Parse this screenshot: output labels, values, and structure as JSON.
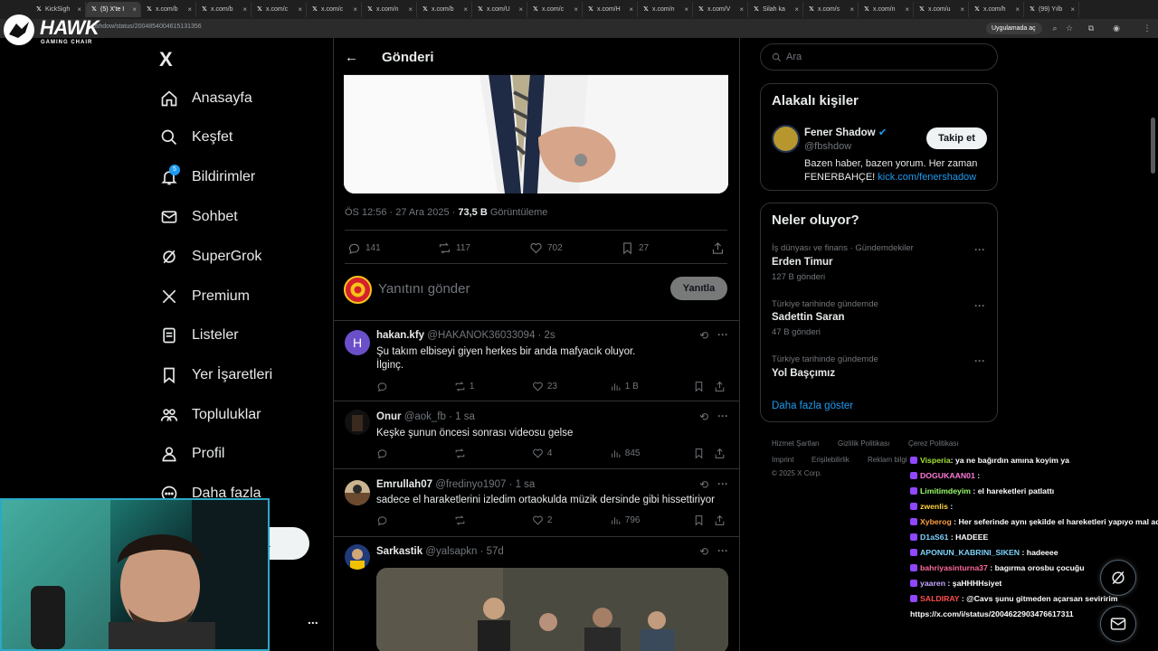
{
  "browser": {
    "tabs": [
      {
        "label": "KickSigh",
        "active": false
      },
      {
        "label": "(5) X'te I",
        "active": true
      },
      {
        "label": "x.com/b",
        "active": false
      },
      {
        "label": "x.com/b",
        "active": false
      },
      {
        "label": "x.com/c",
        "active": false
      },
      {
        "label": "x.com/c",
        "active": false
      },
      {
        "label": "x.com/n",
        "active": false
      },
      {
        "label": "x.com/b",
        "active": false
      },
      {
        "label": "x.com/U",
        "active": false
      },
      {
        "label": "x.com/c",
        "active": false
      },
      {
        "label": "x.com/H",
        "active": false
      },
      {
        "label": "x.com/n",
        "active": false
      },
      {
        "label": "x.com/V",
        "active": false
      },
      {
        "label": "Silah ka",
        "active": false
      },
      {
        "label": "x.com/s",
        "active": false
      },
      {
        "label": "x.com/n",
        "active": false
      },
      {
        "label": "x.com/u",
        "active": false
      },
      {
        "label": "x.com/h",
        "active": false
      },
      {
        "label": "(99) Yılb",
        "active": false
      }
    ],
    "url": "bshdow/status/2004854004615131356",
    "app_chip": "Uygulamada aç"
  },
  "overlay": {
    "brand": "HAWK",
    "brand_sub": "GAMING CHAIR"
  },
  "nav": {
    "logo": "X",
    "notif_count": "5",
    "items": [
      {
        "label": "Anasayfa"
      },
      {
        "label": "Keşfet"
      },
      {
        "label": "Bildirimler"
      },
      {
        "label": "Sohbet"
      },
      {
        "label": "SuperGrok"
      },
      {
        "label": "Premium"
      },
      {
        "label": "Listeler"
      },
      {
        "label": "Yer İşaretleri"
      },
      {
        "label": "Topluluklar"
      },
      {
        "label": "Profil"
      },
      {
        "label": "Daha fazla"
      }
    ],
    "post_button_partial": "a",
    "account_more": "..."
  },
  "post": {
    "title": "Gönderi",
    "time": "ÖS 12:56 · 27 Ara 2025 · ",
    "views": "73,5 B",
    "views_label": " Görüntüleme",
    "stats": {
      "replies": "141",
      "reposts": "117",
      "likes": "702",
      "bookmarks": "27"
    },
    "reply_placeholder": "Yanıtını gönder",
    "reply_button": "Yanıtla"
  },
  "replies": [
    {
      "name": "hakan.kfy",
      "handle": "@HAKANOK36033094 · 2s",
      "initial": "H",
      "text_lines": [
        "Şu takım elbiseyi giyen herkes bir anda mafyacık oluyor.",
        "İlginç."
      ],
      "replies": "",
      "reposts": "1",
      "likes": "23",
      "views": "1 B"
    },
    {
      "name": "Onur",
      "handle": "@aok_fb · 1 sa",
      "initial": "",
      "text_lines": [
        "Keşke şunun öncesi sonrası videosu gelse"
      ],
      "replies": "",
      "reposts": "",
      "likes": "4",
      "views": "845"
    },
    {
      "name": "Emrullah07",
      "handle": "@fredinyo1907 · 1 sa",
      "initial": "",
      "text_lines": [
        "sadece el haraketlerini izledim ortaokulda müzik dersinde gibi hissettiriyor"
      ],
      "replies": "",
      "reposts": "",
      "likes": "2",
      "views": "796"
    },
    {
      "name": "Sarkastik",
      "handle": "@yalsapkn · 57d",
      "initial": "",
      "text_lines": [],
      "replies": "",
      "reposts": "",
      "likes": "",
      "views": ""
    }
  ],
  "sidebar": {
    "search_placeholder": "Ara",
    "related_title": "Alakalı kişiler",
    "person": {
      "name": "Fener Shadow",
      "handle": "@fbshdow",
      "follow": "Takip et",
      "bio_prefix": "Bazen haber, bazen yorum. Her zaman FENERBAHÇE! ",
      "bio_link": "kick.com/fenershadow"
    },
    "trends_title": "Neler oluyor?",
    "trends": [
      {
        "category": "İş dünyası ve finans · Gündemdekiler",
        "name": "Erden Timur",
        "count": "127 B gönderi"
      },
      {
        "category": "Türkiye tarihinde gündemde",
        "name": "Sadettin Saran",
        "count": "47 B gönderi"
      },
      {
        "category": "Türkiye tarihinde gündemde",
        "name": "Yol Başçımız",
        "count": ""
      }
    ],
    "show_more": "Daha fazla göster",
    "footer": [
      "Hizmet Şartları",
      "Gizlilik Politikası",
      "Çerez Politikası",
      "Imprint",
      "Erişilebilirlik",
      "Reklam bilgi",
      "© 2025 X Corp."
    ]
  },
  "chat": [
    {
      "user": "Visperia",
      "msg": ": ya ne bağırdın amına koyim ya",
      "color": "#a3e635"
    },
    {
      "user": "DOGUKAAN01",
      "msg": " :",
      "color": "#ff7ad9"
    },
    {
      "user": "Limitimdeyim",
      "msg": " : el hareketleri patlattı",
      "color": "#9aff6b"
    },
    {
      "user": "zwenlis",
      "msg": " :",
      "color": "#ffd23f"
    },
    {
      "user": "Xyberog",
      "msg": " : Her seferinde aynı şekilde el hareketleri yapıyo mal aq @Cavs",
      "color": "#ff9f43"
    },
    {
      "user": "D1aS61",
      "msg": " : HADEEE",
      "color": "#7dd3fc"
    },
    {
      "user": "APONUN_KABRINI_SIKEN",
      "msg": " : hadeeee",
      "color": "#7dd3fc"
    },
    {
      "user": "bahriyasinturna37",
      "msg": " : bagırma orosbu çocuğu",
      "color": "#ff6b9a"
    },
    {
      "user": "yaaren",
      "msg": " : şaHHHHsiyet",
      "color": "#c4a7ff"
    },
    {
      "user": "SALDIRAY",
      "msg": " : @Cavs şunu gitmeden açarsan seviririm",
      "color": "#ff4d4d"
    },
    {
      "user": "",
      "msg": "https://x.com/i/status/2004622903476617311",
      "color": "#ffffff"
    }
  ],
  "colors": {
    "accent": "#1d9bf0",
    "border": "#2f3336",
    "muted": "#71767b"
  }
}
